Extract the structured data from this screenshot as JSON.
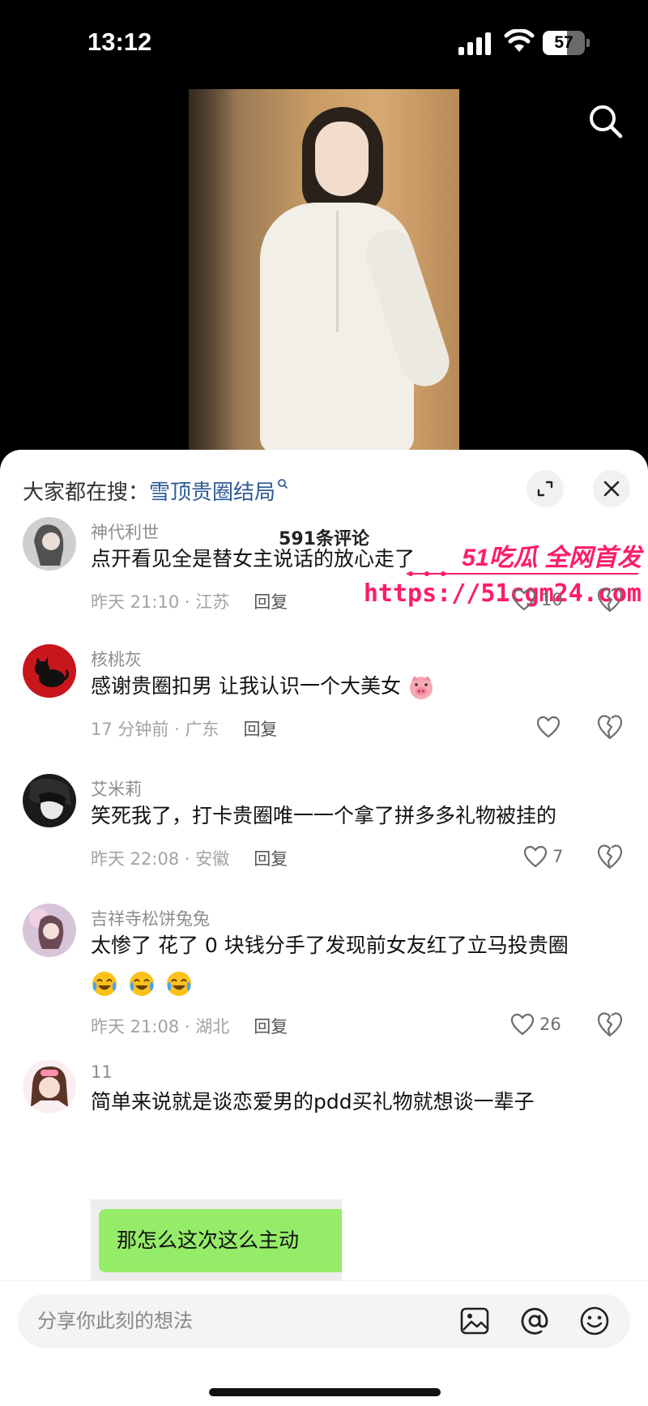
{
  "status_bar": {
    "time": "13:12",
    "battery": "57"
  },
  "sheet": {
    "trending_prefix": "大家都在搜：",
    "trending_query": "雪顶贵圈结局",
    "comment_count": "591条评论"
  },
  "watermark": {
    "line1": "51吃瓜 全网首发",
    "url": "https://51cgm24.com"
  },
  "comments": [
    {
      "username": "神代利世",
      "text": "点开看见全是替女主说话的放心走了",
      "time_location": "昨天 21:10 · 江苏",
      "reply_label": "回复",
      "likes": "10"
    },
    {
      "username": "核桃灰",
      "text": "感谢贵圈扣男 让我认识一个大美女",
      "emoji": "pig-face-icon",
      "time_location": "17 分钟前 · 广东",
      "reply_label": "回复",
      "likes": ""
    },
    {
      "username": "艾米莉",
      "text": "笑死我了，打卡贵圈唯一一个拿了拼多多礼物被挂的",
      "time_location": "昨天 22:08 · 安徽",
      "reply_label": "回复",
      "likes": "7"
    },
    {
      "username": "吉祥寺松饼兔兔",
      "text": "太惨了 花了 0 块钱分手了发现前女友红了立马投贵圈",
      "emoji": "crying-laughing-icon",
      "time_location": "昨天 21:08 · 湖北",
      "reply_label": "回复",
      "likes": "26"
    },
    {
      "username": "11",
      "text": "简单来说就是谈恋爱男的pdd买礼物就想谈一辈子",
      "image_text": "那怎么这次这么主动"
    }
  ],
  "input": {
    "placeholder": "分享你此刻的想法"
  },
  "colors": {
    "link_blue": "#2e5a96",
    "watermark_pink": "#ff1b6b",
    "chat_green": "#95ec69"
  }
}
